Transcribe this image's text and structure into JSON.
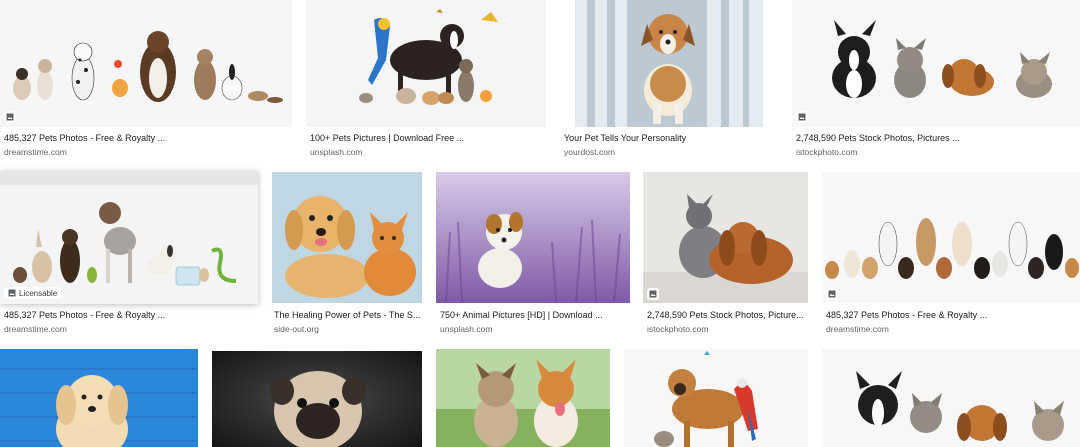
{
  "results": [
    {
      "title": "485,327 Pets Photos - Free & Royalty ...",
      "source": "dreamstime.com",
      "badge": ""
    },
    {
      "title": "100+ Pets Pictures | Download Free ...",
      "source": "unsplash.com",
      "badge": ""
    },
    {
      "title": "Your Pet Tells Your Personality",
      "source": "yourdost.com",
      "badge": ""
    },
    {
      "title": "2,748,590 Pets Stock Photos, Pictures ...",
      "source": "istockphoto.com",
      "badge": ""
    },
    {
      "title": "485,327 Pets Photos - Free & Royalty ...",
      "source": "dreamstime.com",
      "badge": "Licensable"
    },
    {
      "title": "The Healing Power of Pets - The S...",
      "source": "side-out.org",
      "badge": ""
    },
    {
      "title": "750+ Animal Pictures [HD] | Download ...",
      "source": "unsplash.com",
      "badge": ""
    },
    {
      "title": "2,748,590 Pets Stock Photos, Picture...",
      "source": "istockphoto.com",
      "badge": ""
    },
    {
      "title": "485,327 Pets Photos - Free & Royalty ...",
      "source": "dreamstime.com",
      "badge": ""
    }
  ],
  "icons": {
    "image_badge": "image-icon"
  }
}
